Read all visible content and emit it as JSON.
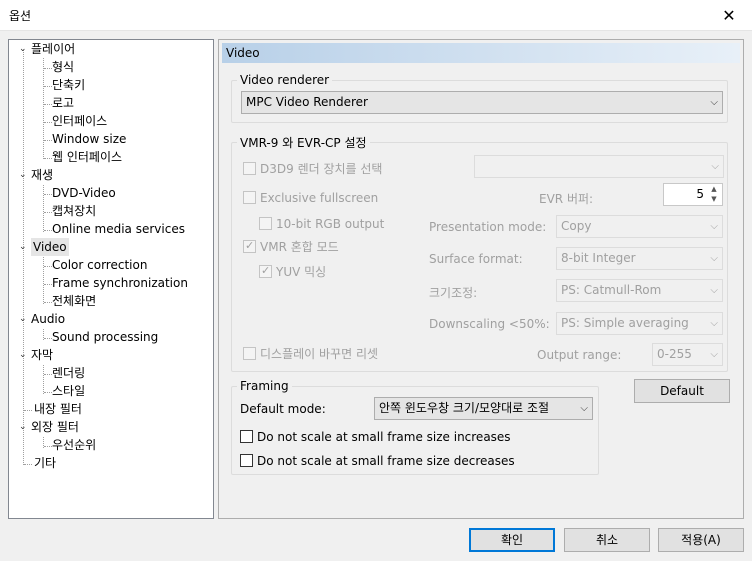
{
  "window": {
    "title": "옵션"
  },
  "tree": [
    {
      "label": "플레이어"
    },
    {
      "label": "형식"
    },
    {
      "label": "단축키"
    },
    {
      "label": "로고"
    },
    {
      "label": "인터페이스"
    },
    {
      "label": "Window size"
    },
    {
      "label": "웹 인터페이스"
    },
    {
      "label": "재생"
    },
    {
      "label": "DVD-Video"
    },
    {
      "label": "캡쳐장치"
    },
    {
      "label": "Online media services"
    },
    {
      "label": "Video"
    },
    {
      "label": "Color correction"
    },
    {
      "label": "Frame synchronization"
    },
    {
      "label": "전체화면"
    },
    {
      "label": "Audio"
    },
    {
      "label": "Sound processing"
    },
    {
      "label": "자막"
    },
    {
      "label": "렌더링"
    },
    {
      "label": "스타일"
    },
    {
      "label": "내장 필터"
    },
    {
      "label": "외장 필터"
    },
    {
      "label": "우선순위"
    },
    {
      "label": "기타"
    }
  ],
  "panel": {
    "header": "Video"
  },
  "renderer": {
    "legend": "Video renderer",
    "value": "MPC Video Renderer"
  },
  "vmr": {
    "legend": "VMR-9 와 EVR-CP 설정",
    "d3d9": "D3D9 렌더 장치를 선택",
    "exclusive": "Exclusive fullscreen",
    "rgb10": "10-bit RGB output",
    "vmr_mix": "VMR 혼합 모드",
    "yuv_mix": "YUV 믹싱",
    "reset": "디스플레이 바꾸면 리셋",
    "evr_buffer_label": "EVR 버퍼:",
    "evr_buffer_value": "5",
    "presentation_label": "Presentation mode:",
    "presentation_value": "Copy",
    "surface_label": "Surface format:",
    "surface_value": "8-bit Integer",
    "resize_label": "크기조정:",
    "resize_value": "PS: Catmull-Rom",
    "downscale_label": "Downscaling <50%:",
    "downscale_value": "PS: Simple averaging",
    "output_label": "Output range:",
    "output_value": "0-255"
  },
  "framing": {
    "legend": "Framing",
    "mode_label": "Default mode:",
    "mode_value": "안쪽 윈도우창 크기/모양대로 조절",
    "no_scale_inc": "Do not scale at small frame size increases",
    "no_scale_dec": "Do not scale at small frame size decreases"
  },
  "buttons": {
    "default": "Default",
    "ok": "확인",
    "cancel": "취소",
    "apply": "적용(A)"
  }
}
